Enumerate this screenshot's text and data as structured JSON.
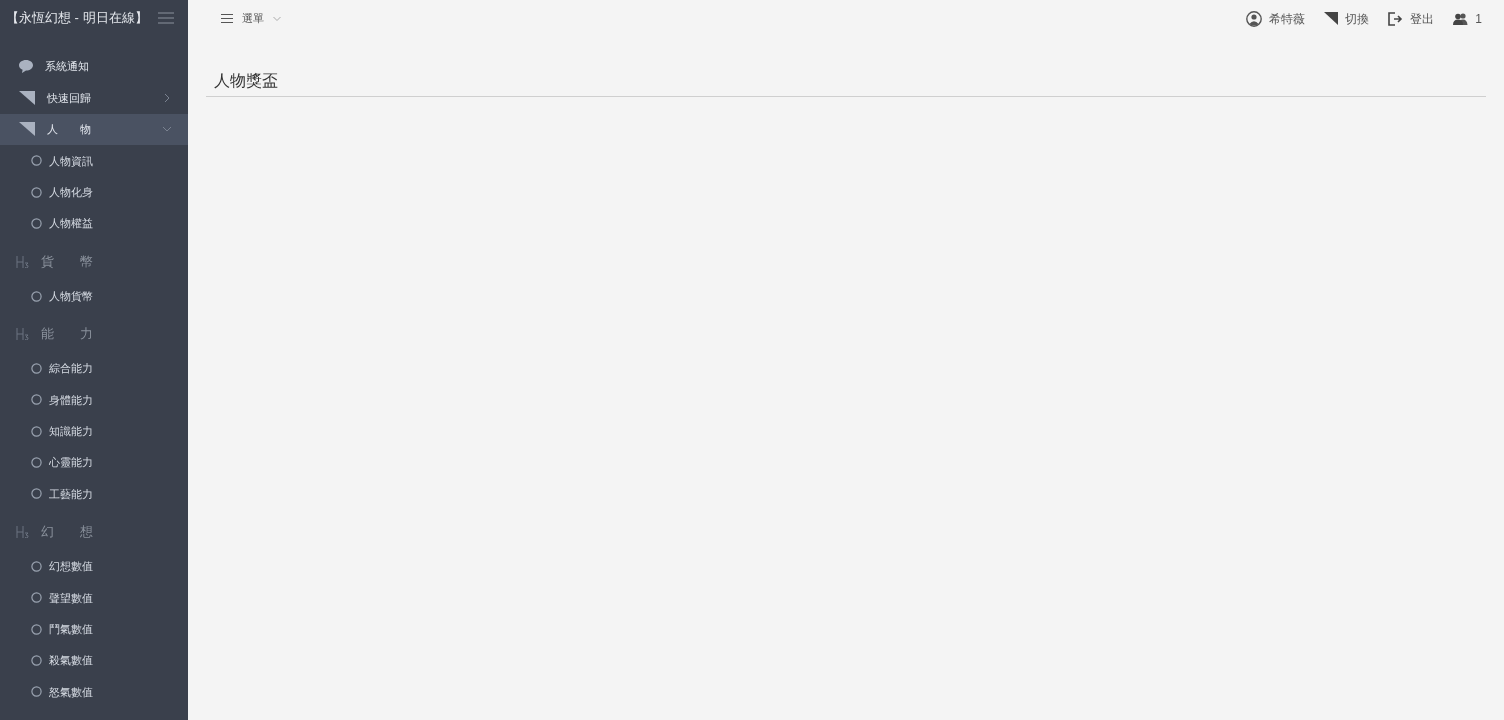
{
  "sidebar": {
    "title": "【永恆幻想 - 明日在線】",
    "items": [
      {
        "kind": "link",
        "label": "系統通知"
      },
      {
        "kind": "group",
        "label": "快速回歸",
        "expanded": false,
        "selected": false
      },
      {
        "kind": "group",
        "label": "人　　物",
        "expanded": true,
        "selected": true,
        "children": [
          {
            "label": "人物資訊"
          },
          {
            "label": "人物化身"
          },
          {
            "label": "人物權益"
          }
        ]
      },
      {
        "kind": "header",
        "label": "貨　　幣",
        "children": [
          {
            "label": "人物貨幣"
          }
        ]
      },
      {
        "kind": "header",
        "label": "能　　力",
        "children": [
          {
            "label": "綜合能力"
          },
          {
            "label": "身體能力"
          },
          {
            "label": "知識能力"
          },
          {
            "label": "心靈能力"
          },
          {
            "label": "工藝能力"
          }
        ]
      },
      {
        "kind": "header",
        "label": "幻　　想",
        "children": [
          {
            "label": "幻想數值"
          },
          {
            "label": "聲望數值"
          },
          {
            "label": "鬥氣數值"
          },
          {
            "label": "殺氣數值"
          },
          {
            "label": "怒氣數值"
          }
        ]
      }
    ]
  },
  "topbar": {
    "menu": "選單",
    "actions": [
      {
        "kind": "user",
        "label": "希特薇"
      },
      {
        "kind": "switch",
        "label": "切換"
      },
      {
        "kind": "logout",
        "label": "登出"
      },
      {
        "kind": "online",
        "label": "1"
      }
    ]
  },
  "page": {
    "title": "人物獎盃"
  }
}
